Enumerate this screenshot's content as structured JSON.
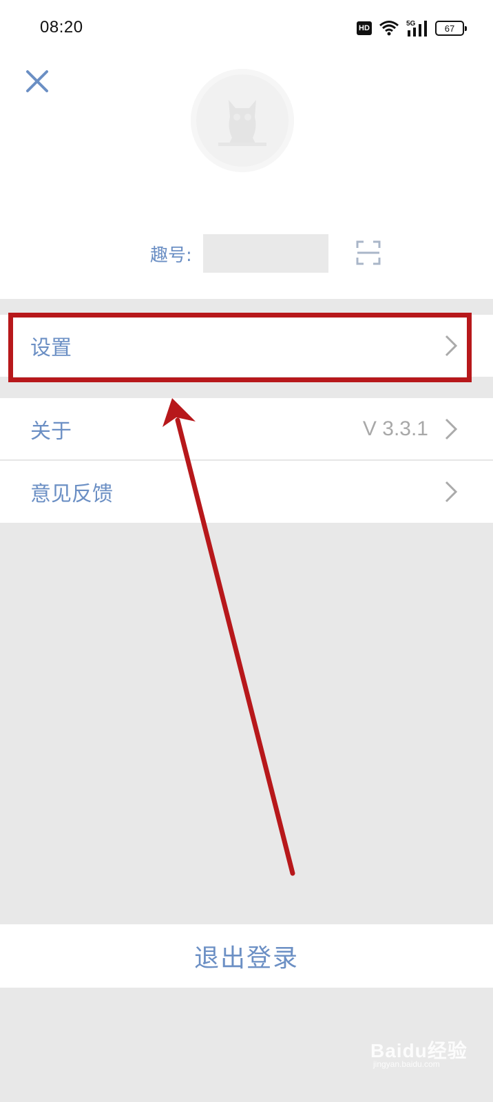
{
  "status_bar": {
    "time": "08:20",
    "hd_label": "HD",
    "network_label": "5G",
    "battery_level": "67"
  },
  "profile": {
    "qu_label": "趣号:",
    "qu_value": ""
  },
  "menu": {
    "settings": {
      "label": "设置"
    },
    "about": {
      "label": "关于",
      "value": "V 3.3.1"
    },
    "feedback": {
      "label": "意见反馈"
    }
  },
  "logout_label": "退出登录",
  "watermark": {
    "text": "Baidu经验",
    "sub": "jingyan.baidu.com"
  },
  "colors": {
    "accent": "#6b8fc4",
    "annotation": "#b7181b",
    "background": "#e8e8e8"
  },
  "icons": [
    "close-icon",
    "avatar-icon",
    "scan-icon",
    "chevron-right-icon",
    "wifi-icon",
    "signal-icon",
    "battery-icon"
  ]
}
